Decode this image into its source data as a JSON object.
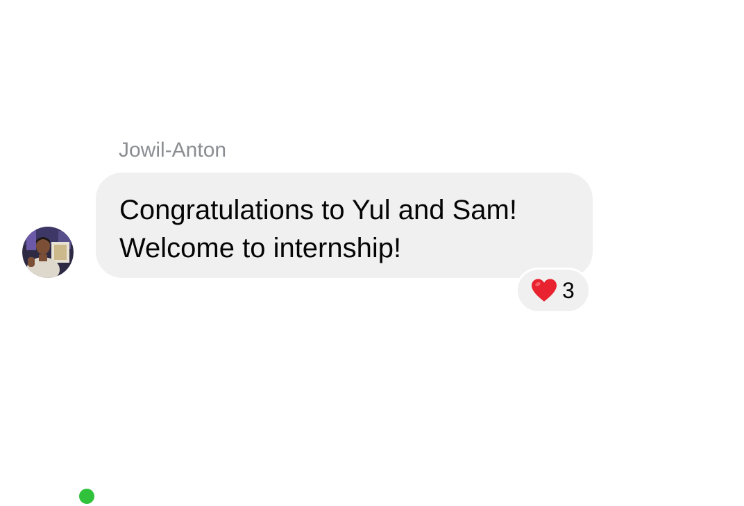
{
  "message": {
    "sender_name": "Jowil-Anton",
    "lines": [
      "Congratulations to Yul and Sam!",
      "Welcome to internship!"
    ],
    "reaction": {
      "icon": "heart-icon",
      "count": "3",
      "color": "#e8222e"
    },
    "avatar": {
      "icon": "user-avatar",
      "online": true,
      "presence_color": "#31c23b"
    },
    "bubble_color": "#f0f0f0",
    "sender_name_color": "#8a8d91"
  }
}
